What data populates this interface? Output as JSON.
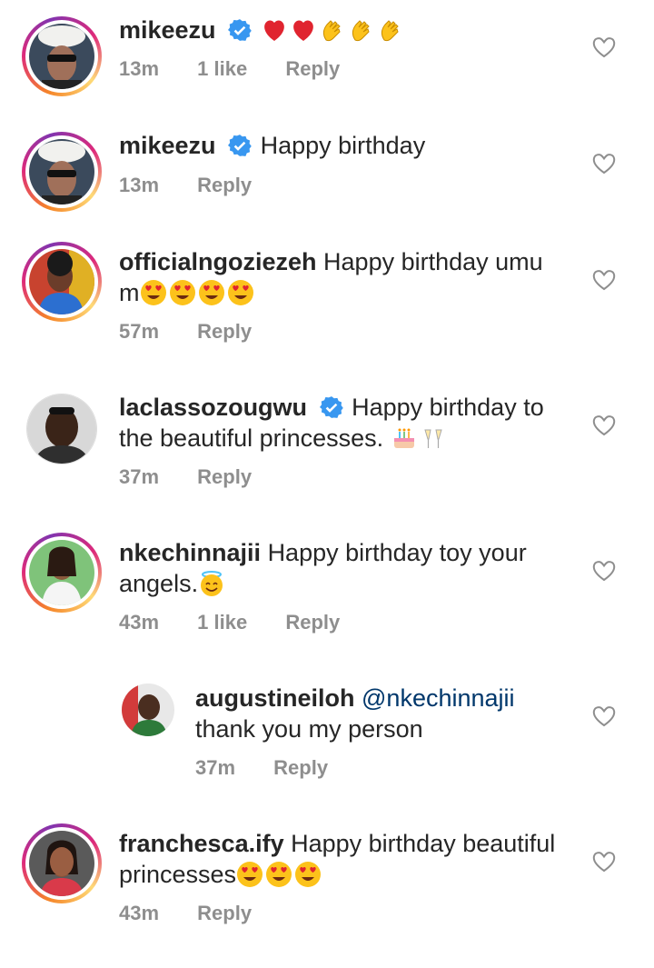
{
  "comments": [
    {
      "username": "mikeezu",
      "verified": true,
      "text": "",
      "emojis": [
        "red-heart",
        "red-heart",
        "clap",
        "clap",
        "clap"
      ],
      "time": "13m",
      "likes": "1 like",
      "reply": "Reply"
    },
    {
      "username": "mikeezu",
      "verified": true,
      "text": "Happy birthday",
      "time": "13m",
      "likes": "",
      "reply": "Reply"
    },
    {
      "username": "officialngoziezeh",
      "verified": false,
      "text": "Happy birthday umu",
      "text2": "m",
      "emojis": [
        "heart-eyes",
        "heart-eyes",
        "heart-eyes",
        "heart-eyes"
      ],
      "time": "57m",
      "likes": "",
      "reply": "Reply"
    },
    {
      "username": "laclassozougwu",
      "verified": true,
      "text": "Happy birthday to",
      "text2": "the beautiful princesses.",
      "emojis": [
        "birthday-cake",
        "champagne-glasses"
      ],
      "time": "37m",
      "likes": "",
      "reply": "Reply"
    },
    {
      "username": "nkechinnajii",
      "verified": false,
      "text": "Happy birthday toy your",
      "text2": "angels.",
      "emojis": [
        "halo-smile"
      ],
      "time": "43m",
      "likes": "1 like",
      "reply": "Reply"
    },
    {
      "username": "augustineiloh",
      "verified": false,
      "mention": "@nkechinnajii",
      "text2": "thank you my person",
      "time": "37m",
      "likes": "",
      "reply": "Reply",
      "is_reply": true
    },
    {
      "username": "franchesca.ify",
      "verified": false,
      "text": "Happy birthday beautiful",
      "text2": "princesses",
      "emojis": [
        "heart-eyes",
        "heart-eyes",
        "heart-eyes"
      ],
      "time": "43m",
      "likes": "",
      "reply": "Reply"
    }
  ],
  "colors": {
    "text": "#262626",
    "meta": "#8e8e8e",
    "verified": "#3897f0",
    "mention": "#00376b"
  }
}
